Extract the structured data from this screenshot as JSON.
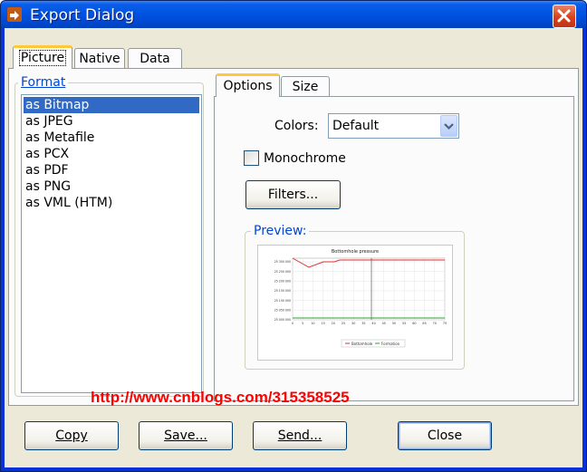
{
  "window": {
    "title": "Export Dialog"
  },
  "main_tabs": [
    {
      "label": "Picture",
      "selected": true
    },
    {
      "label": "Native",
      "selected": false
    },
    {
      "label": "Data",
      "selected": false
    }
  ],
  "format": {
    "legend": "Format",
    "items": [
      "as Bitmap",
      "as JPEG",
      "as Metafile",
      "as PCX",
      "as PDF",
      "as PNG",
      "as VML (HTM)"
    ],
    "selected": "as Bitmap"
  },
  "sub_tabs": [
    {
      "label": "Options",
      "selected": true
    },
    {
      "label": "Size",
      "selected": false
    }
  ],
  "options": {
    "colors_label": "Colors:",
    "colors_value": "Default",
    "monochrome_label": "Monochrome",
    "monochrome_checked": false,
    "filters_label": "Filters...",
    "preview_legend": "Preview:"
  },
  "preview_chart": {
    "title": "Bottomhole pressure",
    "y_ticks": [
      "25 300 000",
      "25 250 000",
      "25 200 000",
      "25 150 000",
      "25 100 000",
      "25 050 000",
      "25 000 000"
    ],
    "x_ticks": [
      "0",
      "5",
      "10",
      "15",
      "20",
      "25",
      "30",
      "35",
      "40",
      "45",
      "50",
      "55",
      "60",
      "65",
      "70",
      "75"
    ],
    "legend": [
      "Bottomhole",
      "Formation"
    ],
    "colors": {
      "bottomhole": "#e03030",
      "formation": "#2ca02c"
    }
  },
  "watermark": "http://www.cnblogs.com/315358525",
  "buttons": {
    "copy": "Copy",
    "save": "Save...",
    "send": "Send...",
    "close": "Close"
  }
}
